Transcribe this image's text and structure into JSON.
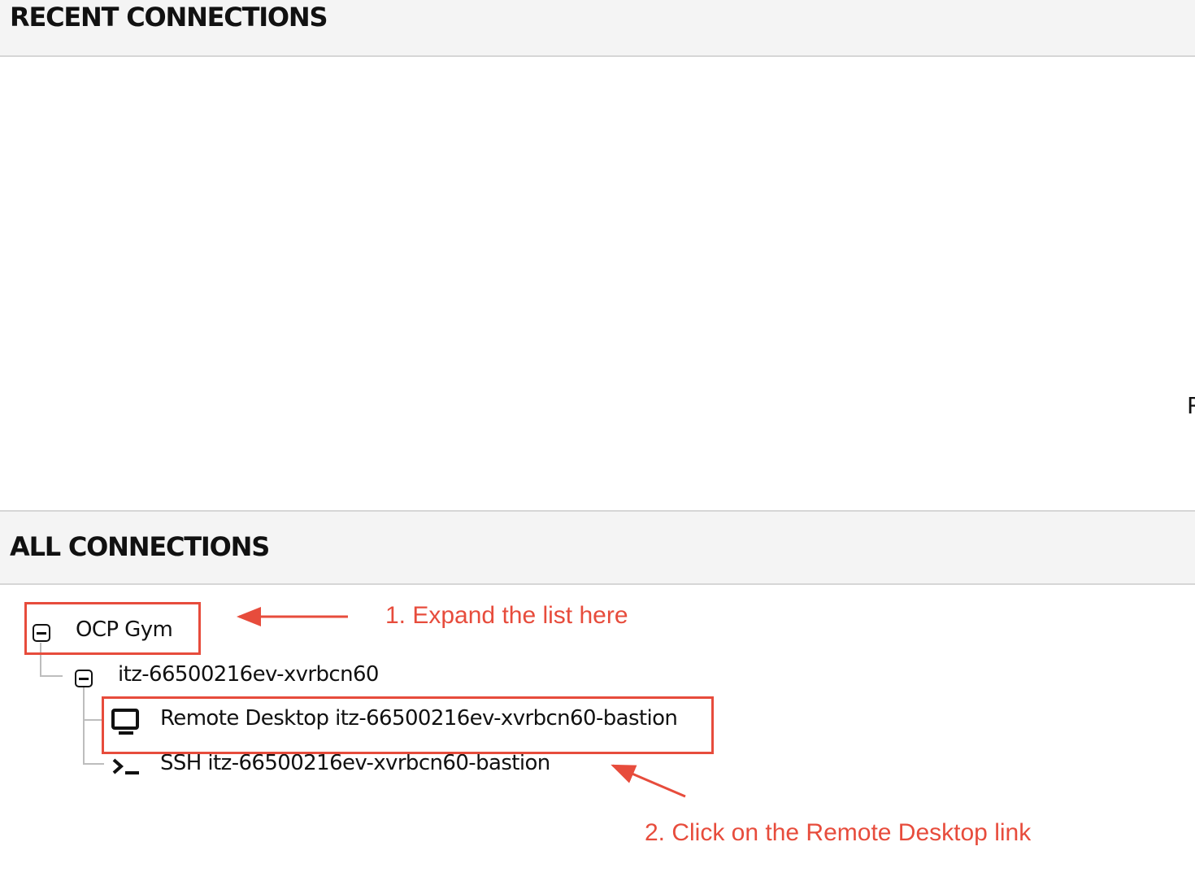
{
  "recent_connections": {
    "title": "RECENT CONNECTIONS",
    "edge_text": "R"
  },
  "all_connections": {
    "title": "ALL CONNECTIONS",
    "tree": {
      "group": {
        "label": "OCP Gym",
        "expanded": true,
        "icon": "collapse-icon"
      },
      "subgroup": {
        "label": "itz-66500216ev-xvrbcn60",
        "expanded": true,
        "icon": "collapse-icon"
      },
      "connections": [
        {
          "label": "Remote Desktop itz-66500216ev-xvrbcn60-bastion",
          "icon": "desktop-icon"
        },
        {
          "label": "SSH itz-66500216ev-xvrbcn60-bastion",
          "icon": "terminal-icon"
        }
      ]
    }
  },
  "annotations": {
    "step1": "1. Expand the list here",
    "step2": "2. Click on the Remote Desktop link",
    "color": "#e74c3c"
  }
}
